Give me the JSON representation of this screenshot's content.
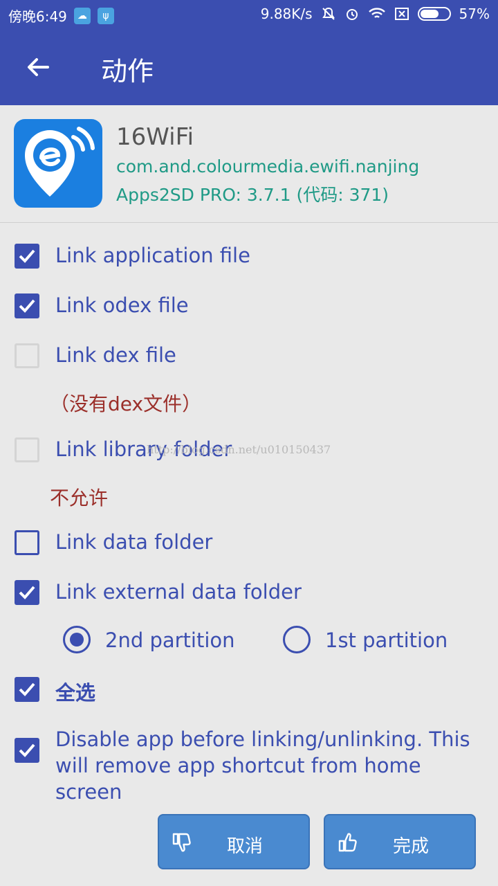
{
  "status_bar": {
    "time": "傍晚6:49",
    "speed": "9.88K/s",
    "battery": "57%"
  },
  "app_bar": {
    "title": "动作"
  },
  "app": {
    "name": "16WiFi",
    "package": "com.and.colourmedia.ewifi.nanjing",
    "version": "Apps2SD PRO: 3.7.1 (代码: 371)"
  },
  "options": {
    "link_app": {
      "label": "Link application file",
      "checked": true
    },
    "link_odex": {
      "label": "Link odex file",
      "checked": true
    },
    "link_dex": {
      "label": "Link dex file",
      "checked": false,
      "note": "（没有dex文件）"
    },
    "link_library": {
      "label": "Link library folder",
      "checked": false,
      "note": "不允许"
    },
    "link_data": {
      "label": "Link data folder",
      "checked": false
    },
    "link_external": {
      "label": "Link external data folder",
      "checked": true
    },
    "select_all": {
      "label": "全选",
      "checked": true
    },
    "disable_app": {
      "label": "Disable app before linking/unlinking. This will remove app shortcut from home screen",
      "checked": true
    }
  },
  "partition": {
    "options": [
      "2nd partition",
      "1st partition"
    ],
    "selected": "2nd partition"
  },
  "watermark": "http://blog.csdn.net/u010150437",
  "buttons": {
    "cancel": "取消",
    "done": "完成"
  },
  "colors": {
    "primary": "#3b4eb0",
    "accent_teal": "#1f9a86",
    "note_red": "#9b2f2a",
    "button_blue": "#4a8ad0",
    "background": "#e9e9e9"
  }
}
